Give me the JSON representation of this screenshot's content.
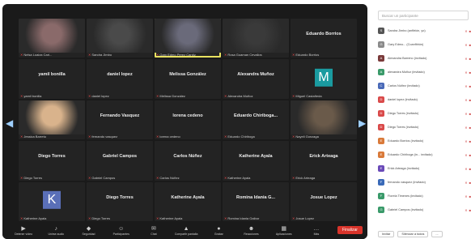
{
  "tiles": [
    {
      "name": "",
      "label": "Nelsa Loaiza Cari...",
      "type": "photo",
      "color": "#8a6a6a"
    },
    {
      "name": "",
      "label": "Sandra Jimbo",
      "type": "photo",
      "color": "#4a4a4a"
    },
    {
      "name": "",
      "label": "Gary Edmo Perez Cardiz",
      "type": "photo",
      "color": "#6a6a7a"
    },
    {
      "name": "",
      "label": "Rosa Guaman Cevallos",
      "type": "photo",
      "color": "#3a3a3a"
    },
    {
      "name": "Eduardo Borrios",
      "label": "Eduardo Borrios",
      "type": "name"
    },
    {
      "name": "yamil bonilla",
      "label": "yamil bonilla",
      "type": "name"
    },
    {
      "name": "daniel lopez",
      "label": "daniel lopez",
      "type": "name"
    },
    {
      "name": "Melissa González",
      "label": "Melissa González",
      "type": "name"
    },
    {
      "name": "Alexandra Muñoz",
      "label": "Alexandra Muñoz",
      "type": "name"
    },
    {
      "name": "",
      "label": "Miguel Castañeda",
      "type": "avatar",
      "letter": "M",
      "color": "#1a9ba0"
    },
    {
      "name": "",
      "label": "Jessica Barreto",
      "type": "photo",
      "color": "#d9b38c"
    },
    {
      "name": "Fernando Vasquez",
      "label": "fernando vasquez",
      "type": "name"
    },
    {
      "name": "lorena cedeno",
      "label": "lorena cedeno",
      "type": "name"
    },
    {
      "name": "Eduardo Chiriboga...",
      "label": "Eduardo Chiriboga",
      "type": "name"
    },
    {
      "name": "",
      "label": "Nayeli Gonzaga",
      "type": "photo",
      "color": "#6a5a4a"
    },
    {
      "name": "Diego Torres",
      "label": "Diego Torres",
      "type": "name"
    },
    {
      "name": "Gabriel Campos",
      "label": "Gabriel Campos",
      "type": "name"
    },
    {
      "name": "Carlos Núñez",
      "label": "Carlos Núñez",
      "type": "name"
    },
    {
      "name": "Katherine Ayala",
      "label": "Katherine Ayala",
      "type": "name"
    },
    {
      "name": "Erick Arteaga",
      "label": "Erick Arteaga",
      "type": "name"
    },
    {
      "name": "",
      "label": "Katherine Ayala",
      "type": "avatar",
      "letter": "K",
      "color": "#5a6fb8"
    },
    {
      "name": "Diego Torres",
      "label": "Diego Torres",
      "type": "name"
    },
    {
      "name": "Katherine Ayala",
      "label": "Katherine Ayala",
      "type": "name"
    },
    {
      "name": "Romina Idania G...",
      "label": "Romina Idania Gaibor",
      "type": "name"
    },
    {
      "name": "Josue Lopez",
      "label": "Josue Lopez",
      "type": "name"
    }
  ],
  "toolbar": {
    "items": [
      {
        "label": "Detener vídeo",
        "icon": "video-icon"
      },
      {
        "label": "Unirse audio",
        "icon": "audio-icon"
      },
      {
        "label": "Seguridad",
        "icon": "shield-icon"
      },
      {
        "label": "Participantes",
        "icon": "participants-icon"
      },
      {
        "label": "Chat",
        "icon": "chat-icon"
      },
      {
        "label": "Compartir pantalla",
        "icon": "share-icon"
      },
      {
        "label": "Grabar",
        "icon": "record-icon"
      },
      {
        "label": "Reacciones",
        "icon": "reactions-icon"
      },
      {
        "label": "Aplicaciones",
        "icon": "apps-icon"
      },
      {
        "label": "Más",
        "icon": "more-icon"
      }
    ],
    "end_label": "Finalizar"
  },
  "panel": {
    "search_placeholder": "Buscar un participante",
    "participants": [
      {
        "name": "Sandra Jimbo (anfitrión, yo)",
        "letter": "S",
        "color": "#555555"
      },
      {
        "name": "Gary Edmo... (Coanfitrión)",
        "letter": "G",
        "color": "#8a8a8a"
      },
      {
        "name": "Alexandra Barreno (invitado)",
        "letter": "A",
        "color": "#7a3a3a"
      },
      {
        "name": "alexandra Muñoz (invitado)",
        "letter": "A",
        "color": "#3a9a6a"
      },
      {
        "name": "Carlos Núñez (invitado)",
        "letter": "C",
        "color": "#4a6ab8"
      },
      {
        "name": "daniel lopez (invitado)",
        "letter": "D",
        "color": "#d94a4a"
      },
      {
        "name": "Diego Torres (invitado)",
        "letter": "D",
        "color": "#d94a4a"
      },
      {
        "name": "Diego Torres (invitado)",
        "letter": "D",
        "color": "#d94a4a"
      },
      {
        "name": "Eduardo Borrios (invitado)",
        "letter": "E",
        "color": "#d97a3a"
      },
      {
        "name": "Eduardo Chiriboga (in... invitado)",
        "letter": "E",
        "color": "#d97a3a"
      },
      {
        "name": "Erick Arteaga (invitado)",
        "letter": "E",
        "color": "#6a4ab8"
      },
      {
        "name": "fernando vasquez (invitado)",
        "letter": "F",
        "color": "#3a6ab8"
      },
      {
        "name": "Fiorela Timenes (invitado)",
        "letter": "F",
        "color": "#3a9a6a"
      },
      {
        "name": "Gabriel Campos (invitado)",
        "letter": "G",
        "color": "#3a9a6a"
      }
    ],
    "footer": [
      "Invitar",
      "Silenciar a todos",
      "..."
    ]
  }
}
